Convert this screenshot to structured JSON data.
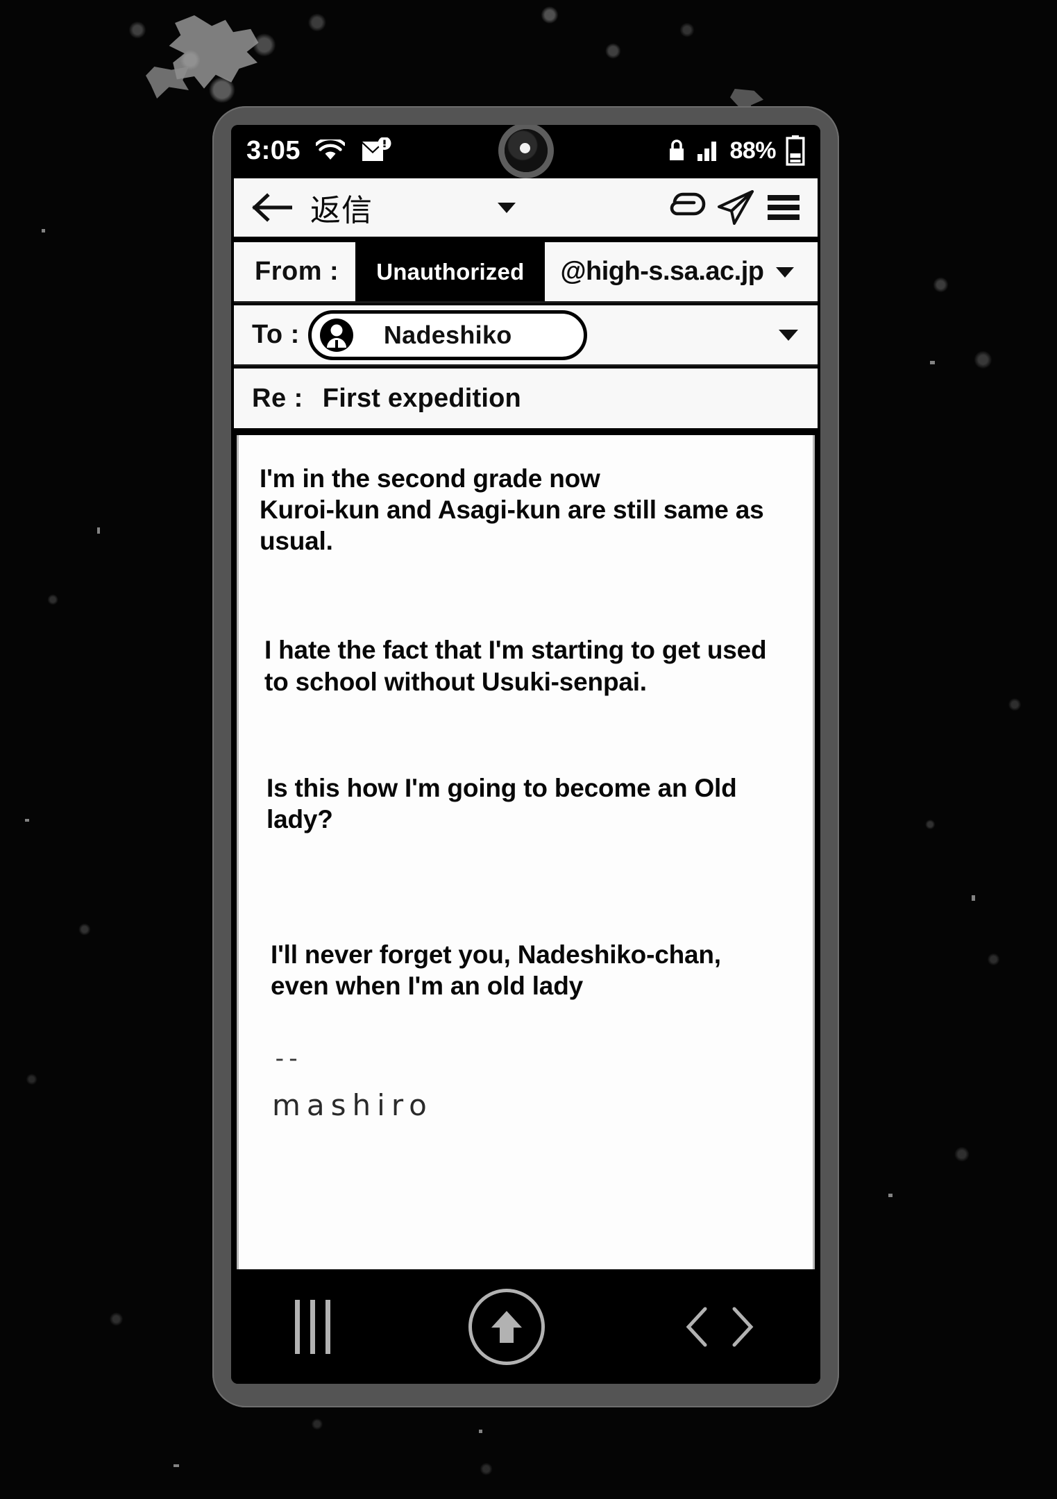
{
  "device": {
    "frame_color": "#545454",
    "screen_bg": "#000000"
  },
  "status_bar": {
    "clock": "3:05",
    "battery_percent": "88%",
    "icons": [
      "wifi-icon",
      "mail-alert-icon",
      "lock-icon",
      "signal-bars-icon",
      "battery-icon"
    ]
  },
  "app_bar": {
    "back_label": "back-arrow-icon",
    "title": "返信",
    "title_caret": "chevron-down-icon",
    "actions": [
      "attachment-icon",
      "send-icon",
      "menu-icon"
    ]
  },
  "compose": {
    "from": {
      "label": "From :",
      "redacted_value": "Unauthorized",
      "domain": "@high-s.sa.ac.jp",
      "caret": "chevron-down-icon"
    },
    "to": {
      "label": "To :",
      "recipient": "Nadeshiko",
      "avatar": "person-avatar-icon",
      "caret": "chevron-down-icon"
    },
    "subject": {
      "label": "Re :",
      "value": "First expedition"
    },
    "body": {
      "paragraphs": [
        "I'm in the second grade now\nKuroi-kun and Asagi-kun are still same as usual.",
        "I hate the fact that I'm starting to get used\nto school without Usuki-senpai.",
        "Is this how I'm going to become an Old lady?",
        "I'll never forget you, Nadeshiko-chan,\neven when I'm an old lady"
      ],
      "signature_separator": "--",
      "signature_name": "mashiro"
    }
  },
  "nav_bar": {
    "recents": "recents-icon",
    "home": "home-up-arrow-icon",
    "back_chevron": "chevron-left-icon",
    "forward_chevron": "chevron-right-icon"
  }
}
